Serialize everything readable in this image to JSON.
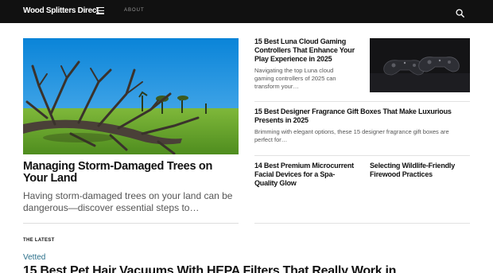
{
  "header": {
    "logo": "Wood Splitters Direct",
    "about_label": "ABOUT",
    "menu_icon": "hamburger-menu-icon",
    "search_icon": "search-icon"
  },
  "hero": {
    "title": "Managing Storm-Damaged Trees on Your Land",
    "description": "Having storm-damaged trees on your land can be dangerous—discover essential steps to…"
  },
  "side_articles": [
    {
      "title": "15 Best Luna Cloud Gaming Controllers That Enhance Your Play Experience in 2025",
      "description": "Navigating the top Luna cloud gaming controllers of 2025 can transform your…"
    },
    {
      "title": "15 Best Designer Fragrance Gift Boxes That Make Luxurious Presents in 2025",
      "description": "Brimming with elegant options, these 15 designer fragrance gift boxes are perfect for…"
    },
    {
      "title": "14 Best Premium Microcurrent Facial Devices for a Spa-Quality Glow"
    },
    {
      "title": "Selecting Wildlife-Friendly Firewood Practices"
    }
  ],
  "latest": {
    "section_label": "THE LATEST",
    "category": "Vetted",
    "title": "15 Best Pet Hair Vacuums With HEPA Filters That Really Work in"
  },
  "colors": {
    "header_bg": "#111111",
    "category": "#2a6f8a",
    "text": "#111111",
    "muted_text": "#555555"
  }
}
